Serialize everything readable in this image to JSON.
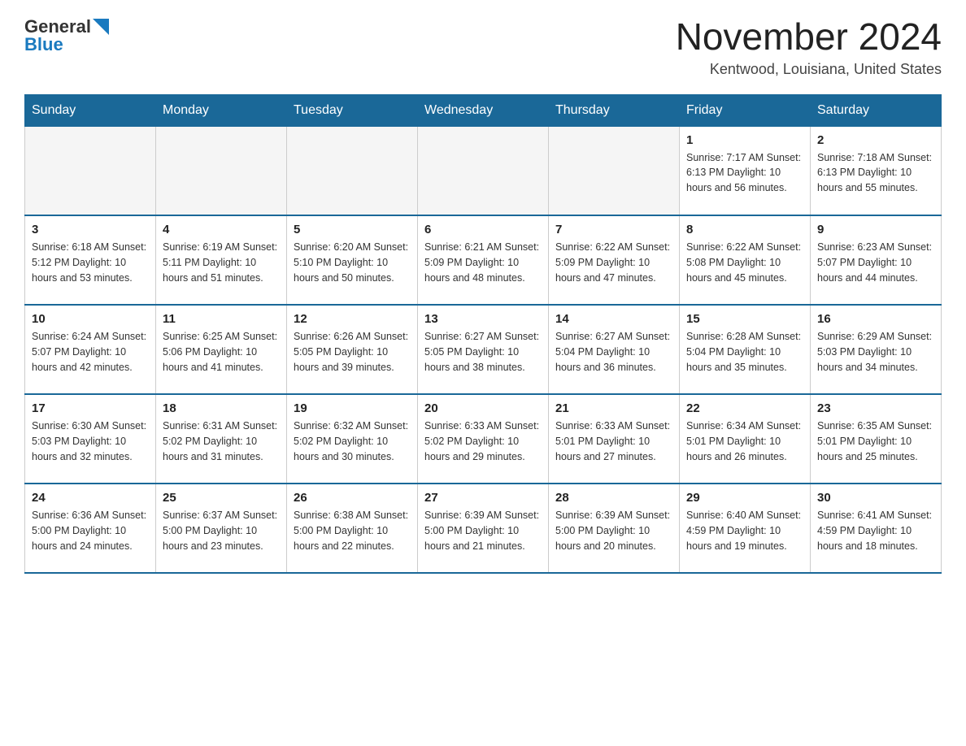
{
  "header": {
    "logo_text_general": "General",
    "logo_text_blue": "Blue",
    "month_title": "November 2024",
    "location": "Kentwood, Louisiana, United States"
  },
  "days_of_week": [
    "Sunday",
    "Monday",
    "Tuesday",
    "Wednesday",
    "Thursday",
    "Friday",
    "Saturday"
  ],
  "weeks": [
    [
      {
        "day": "",
        "info": ""
      },
      {
        "day": "",
        "info": ""
      },
      {
        "day": "",
        "info": ""
      },
      {
        "day": "",
        "info": ""
      },
      {
        "day": "",
        "info": ""
      },
      {
        "day": "1",
        "info": "Sunrise: 7:17 AM\nSunset: 6:13 PM\nDaylight: 10 hours and 56 minutes."
      },
      {
        "day": "2",
        "info": "Sunrise: 7:18 AM\nSunset: 6:13 PM\nDaylight: 10 hours and 55 minutes."
      }
    ],
    [
      {
        "day": "3",
        "info": "Sunrise: 6:18 AM\nSunset: 5:12 PM\nDaylight: 10 hours and 53 minutes."
      },
      {
        "day": "4",
        "info": "Sunrise: 6:19 AM\nSunset: 5:11 PM\nDaylight: 10 hours and 51 minutes."
      },
      {
        "day": "5",
        "info": "Sunrise: 6:20 AM\nSunset: 5:10 PM\nDaylight: 10 hours and 50 minutes."
      },
      {
        "day": "6",
        "info": "Sunrise: 6:21 AM\nSunset: 5:09 PM\nDaylight: 10 hours and 48 minutes."
      },
      {
        "day": "7",
        "info": "Sunrise: 6:22 AM\nSunset: 5:09 PM\nDaylight: 10 hours and 47 minutes."
      },
      {
        "day": "8",
        "info": "Sunrise: 6:22 AM\nSunset: 5:08 PM\nDaylight: 10 hours and 45 minutes."
      },
      {
        "day": "9",
        "info": "Sunrise: 6:23 AM\nSunset: 5:07 PM\nDaylight: 10 hours and 44 minutes."
      }
    ],
    [
      {
        "day": "10",
        "info": "Sunrise: 6:24 AM\nSunset: 5:07 PM\nDaylight: 10 hours and 42 minutes."
      },
      {
        "day": "11",
        "info": "Sunrise: 6:25 AM\nSunset: 5:06 PM\nDaylight: 10 hours and 41 minutes."
      },
      {
        "day": "12",
        "info": "Sunrise: 6:26 AM\nSunset: 5:05 PM\nDaylight: 10 hours and 39 minutes."
      },
      {
        "day": "13",
        "info": "Sunrise: 6:27 AM\nSunset: 5:05 PM\nDaylight: 10 hours and 38 minutes."
      },
      {
        "day": "14",
        "info": "Sunrise: 6:27 AM\nSunset: 5:04 PM\nDaylight: 10 hours and 36 minutes."
      },
      {
        "day": "15",
        "info": "Sunrise: 6:28 AM\nSunset: 5:04 PM\nDaylight: 10 hours and 35 minutes."
      },
      {
        "day": "16",
        "info": "Sunrise: 6:29 AM\nSunset: 5:03 PM\nDaylight: 10 hours and 34 minutes."
      }
    ],
    [
      {
        "day": "17",
        "info": "Sunrise: 6:30 AM\nSunset: 5:03 PM\nDaylight: 10 hours and 32 minutes."
      },
      {
        "day": "18",
        "info": "Sunrise: 6:31 AM\nSunset: 5:02 PM\nDaylight: 10 hours and 31 minutes."
      },
      {
        "day": "19",
        "info": "Sunrise: 6:32 AM\nSunset: 5:02 PM\nDaylight: 10 hours and 30 minutes."
      },
      {
        "day": "20",
        "info": "Sunrise: 6:33 AM\nSunset: 5:02 PM\nDaylight: 10 hours and 29 minutes."
      },
      {
        "day": "21",
        "info": "Sunrise: 6:33 AM\nSunset: 5:01 PM\nDaylight: 10 hours and 27 minutes."
      },
      {
        "day": "22",
        "info": "Sunrise: 6:34 AM\nSunset: 5:01 PM\nDaylight: 10 hours and 26 minutes."
      },
      {
        "day": "23",
        "info": "Sunrise: 6:35 AM\nSunset: 5:01 PM\nDaylight: 10 hours and 25 minutes."
      }
    ],
    [
      {
        "day": "24",
        "info": "Sunrise: 6:36 AM\nSunset: 5:00 PM\nDaylight: 10 hours and 24 minutes."
      },
      {
        "day": "25",
        "info": "Sunrise: 6:37 AM\nSunset: 5:00 PM\nDaylight: 10 hours and 23 minutes."
      },
      {
        "day": "26",
        "info": "Sunrise: 6:38 AM\nSunset: 5:00 PM\nDaylight: 10 hours and 22 minutes."
      },
      {
        "day": "27",
        "info": "Sunrise: 6:39 AM\nSunset: 5:00 PM\nDaylight: 10 hours and 21 minutes."
      },
      {
        "day": "28",
        "info": "Sunrise: 6:39 AM\nSunset: 5:00 PM\nDaylight: 10 hours and 20 minutes."
      },
      {
        "day": "29",
        "info": "Sunrise: 6:40 AM\nSunset: 4:59 PM\nDaylight: 10 hours and 19 minutes."
      },
      {
        "day": "30",
        "info": "Sunrise: 6:41 AM\nSunset: 4:59 PM\nDaylight: 10 hours and 18 minutes."
      }
    ]
  ],
  "colors": {
    "header_bg": "#1a6898",
    "border_accent": "#1a6898"
  }
}
